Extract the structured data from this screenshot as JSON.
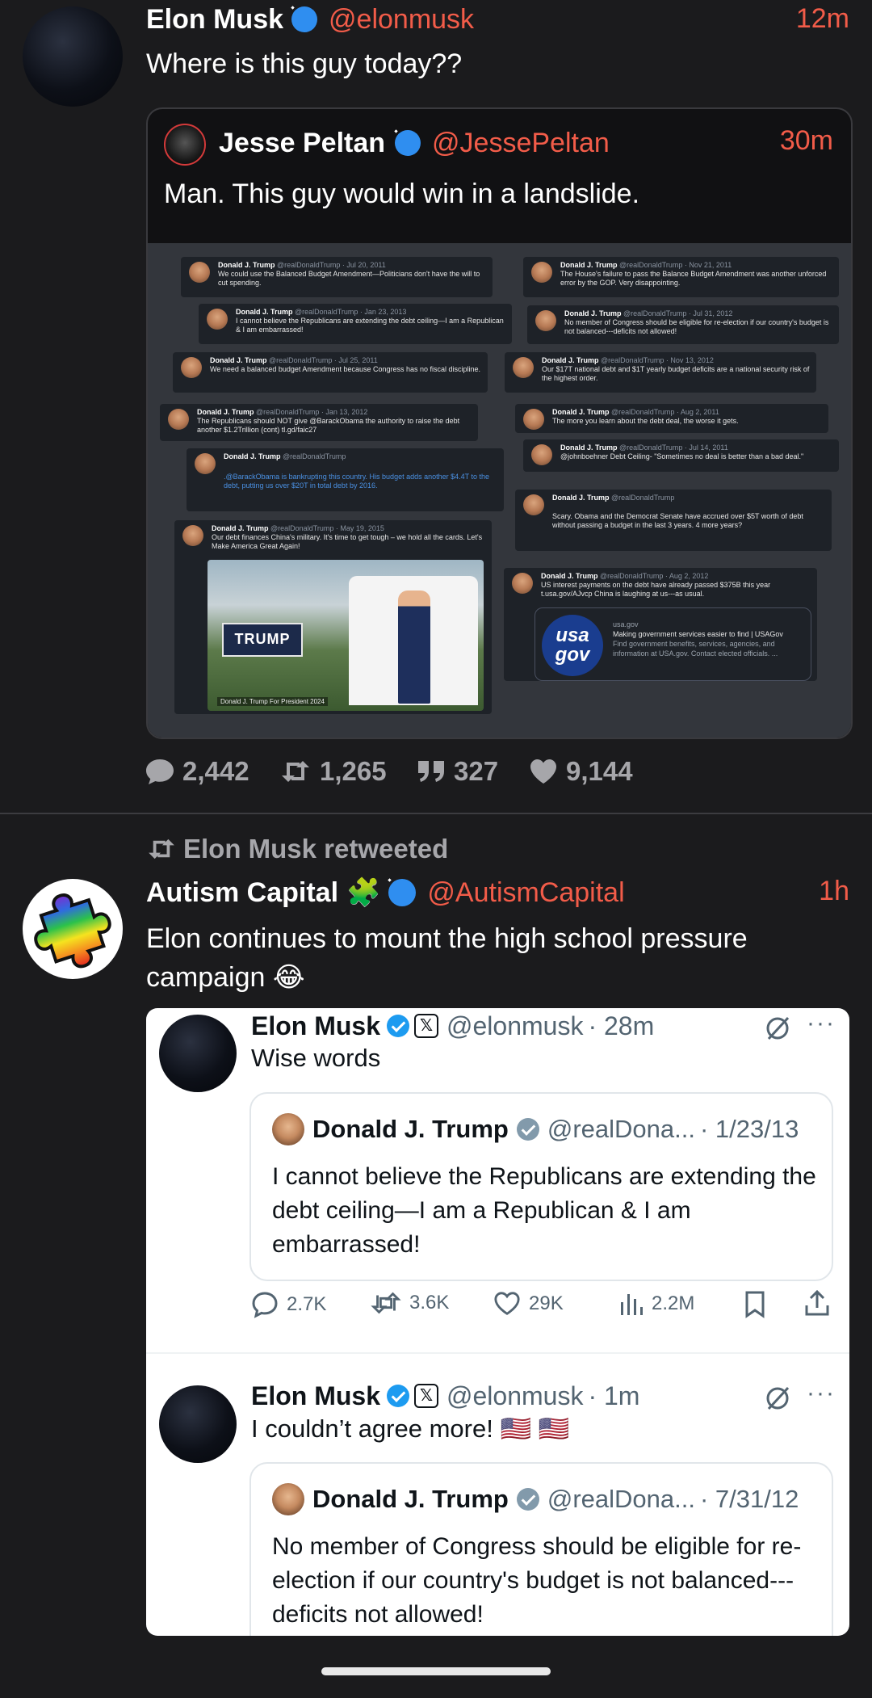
{
  "tweet1": {
    "author_name": "Elon Musk",
    "handle": "@elonmusk",
    "time": "12m",
    "text": "Where is this guy today??",
    "quoted": {
      "author_name": "Jesse Peltan",
      "handle": "@JessePeltan",
      "time": "30m",
      "text": "Man. This guy would win in a landslide.",
      "image": {
        "mini_tweets_left": [
          {
            "name": "Donald J. Trump",
            "meta": "@realDonaldTrump · Jul 20, 2011",
            "text": "We could use the Balanced Budget Amendment—Politicians don't have the will to cut spending."
          },
          {
            "name": "Donald J. Trump",
            "meta": "@realDonaldTrump · Jan 23, 2013",
            "text": "I cannot believe the Republicans are extending the debt ceiling—I am a Republican & I am embarrassed!"
          },
          {
            "name": "Donald J. Trump",
            "meta": "@realDonaldTrump · Jul 25, 2011",
            "text": "We need a balanced budget Amendment because Congress has no fiscal discipline."
          },
          {
            "name": "Donald J. Trump",
            "meta": "@realDonaldTrump · Jan 13, 2012",
            "text": "The Republicans should NOT give @BarackObama the authority to raise the debt another $1.2Trillion (cont) tl.gd/faic27"
          },
          {
            "name": "Donald J. Trump",
            "meta": "@realDonaldTrump",
            "text": ".@BarackObama is bankrupting this country. His budget adds another $4.4T to the debt, putting us over $20T in total debt by 2016."
          },
          {
            "name": "Donald J. Trump",
            "meta": "@realDonaldTrump · May 19, 2015",
            "text": "Our debt finances China's military. It's time to get tough – we hold all the cards. Let's Make America Great Again!"
          }
        ],
        "mini_tweets_right": [
          {
            "name": "Donald J. Trump",
            "meta": "@realDonaldTrump · Nov 21, 2011",
            "text": "The House's failure to pass the Balance Budget Amendment was another unforced error by the GOP. Very disappointing."
          },
          {
            "name": "Donald J. Trump",
            "meta": "@realDonaldTrump · Jul 31, 2012",
            "text": "No member of Congress should be eligible for re-election if our country's budget is not balanced---deficits not allowed!"
          },
          {
            "name": "Donald J. Trump",
            "meta": "@realDonaldTrump · Nov 13, 2012",
            "text": "Our $17T national debt and $1T yearly budget deficits are a national security risk of the highest order."
          },
          {
            "name": "Donald J. Trump",
            "meta": "@realDonaldTrump · Aug 2, 2011",
            "text": "The more you learn about the debt deal, the worse it gets."
          },
          {
            "name": "Donald J. Trump",
            "meta": "@realDonaldTrump · Jul 14, 2011",
            "text": "@johnboehner Debt Ceiling- \"Sometimes no deal is better than a bad deal.\""
          },
          {
            "name": "Donald J. Trump",
            "meta": "@realDonaldTrump",
            "text": "Scary. Obama and the Democrat Senate have accrued over $5T worth of debt without passing a budget in the last 3 years. 4 more years?"
          },
          {
            "name": "Donald J. Trump",
            "meta": "@realDonaldTrump · Aug 2, 2012",
            "text": "US interest payments on the debt have already passed $375B this year t.usa.gov/AJvcp China is laughing at us---as usual."
          }
        ],
        "photo_banner": "TRUMP",
        "photo_caption": "Donald J. Trump For President 2024",
        "usagov": {
          "logo": "usa gov",
          "domain": "usa.gov",
          "title": "Making government services easier to find | USAGov",
          "desc": "Find government benefits, services, agencies, and information at USA.gov. Contact elected officials. ..."
        }
      }
    },
    "stats": {
      "replies": "2,442",
      "retweets": "1,265",
      "quotes": "327",
      "likes": "9,144"
    }
  },
  "tweet2": {
    "retweet_label": "Elon Musk retweeted",
    "author_name": "Autism Capital",
    "author_emoji": "🧩",
    "handle": "@AutismCapital",
    "time": "1h",
    "text": "Elon continues to mount the high school pressure campaign 😂",
    "embedded": [
      {
        "author_name": "Elon Musk",
        "handle": "@elonmusk",
        "time": "· 28m",
        "text": "Wise words",
        "quoted": {
          "author_name": "Donald J. Trump",
          "handle": "@realDona...",
          "date": "· 1/23/13",
          "text": "I cannot believe the Republicans are extending the debt ceiling—I am a Republican & I am embarrassed!"
        },
        "actions": {
          "replies": "2.7K",
          "reposts": "3.6K",
          "likes": "29K",
          "views": "2.2M"
        }
      },
      {
        "author_name": "Elon Musk",
        "handle": "@elonmusk",
        "time": "· 1m",
        "text": "I couldn’t agree more! 🇺🇸 🇺🇸",
        "quoted": {
          "author_name": "Donald J. Trump",
          "handle": "@realDona...",
          "date": "· 7/31/12",
          "text": "No member of Congress should be eligible for re-election if our country's budget is not balanced---deficits not allowed!"
        }
      }
    ]
  },
  "colors": {
    "background": "#1b1b1d",
    "accent": "#f25c49",
    "verified": "#2f8ef0",
    "muted": "#a6a6aa"
  }
}
